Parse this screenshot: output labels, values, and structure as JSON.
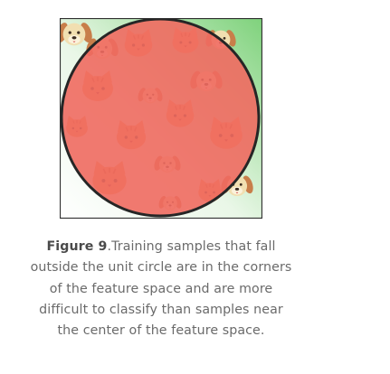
{
  "figure": {
    "label": "Figure 9",
    "caption": ".Training samples that fall outside the unit circle are in the corners of the feature space and are more difficult to classify than samples near the center of the feature space."
  },
  "colors": {
    "frame": "#2f2f2f",
    "circle_fill": "#f06a60",
    "circle_stroke": "#262626",
    "background_green": "#7fd27c",
    "cat_orange": "#f0a060",
    "dog_brown": "#c87e4a",
    "dog_cream": "#f1dfb1"
  },
  "icons": [
    "cat-face-icon",
    "dog-face-icon"
  ]
}
